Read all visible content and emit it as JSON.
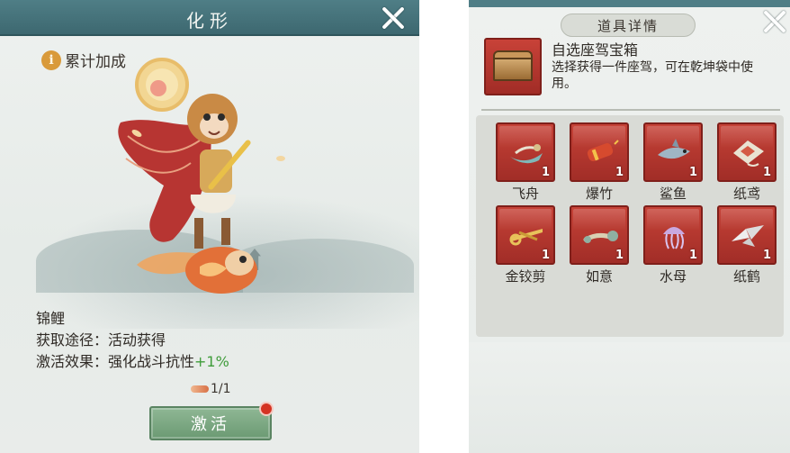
{
  "left": {
    "title": "化形",
    "bonus_icon": "i",
    "bonus_label": "累计加成",
    "mount_name": "锦鲤",
    "source_line": "获取途径：活动获得",
    "effect_prefix": "激活效果：强化战斗抗性",
    "effect_value": "+1%",
    "count": "1/1",
    "activate_label": "激活"
  },
  "right": {
    "title": "道具详情",
    "item_name": "自选座驾宝箱",
    "item_desc": "选择获得一件座驾，可在乾坤袋中使用。",
    "items": [
      {
        "label": "飞舟",
        "qty": "1",
        "icon": "flying-boat-icon"
      },
      {
        "label": "爆竹",
        "qty": "1",
        "icon": "firecracker-icon"
      },
      {
        "label": "鲨鱼",
        "qty": "1",
        "icon": "shark-icon"
      },
      {
        "label": "纸鸢",
        "qty": "1",
        "icon": "kite-icon"
      },
      {
        "label": "金铰剪",
        "qty": "1",
        "icon": "golden-scissors-icon"
      },
      {
        "label": "如意",
        "qty": "1",
        "icon": "ruyi-scepter-icon"
      },
      {
        "label": "水母",
        "qty": "1",
        "icon": "jellyfish-icon"
      },
      {
        "label": "纸鹤",
        "qty": "1",
        "icon": "paper-crane-icon"
      }
    ]
  },
  "colors": {
    "header_teal": "#4f7e86",
    "tile_red": "#b8362f",
    "button_green": "#7ea886",
    "bonus_green": "#3f9c3a"
  }
}
